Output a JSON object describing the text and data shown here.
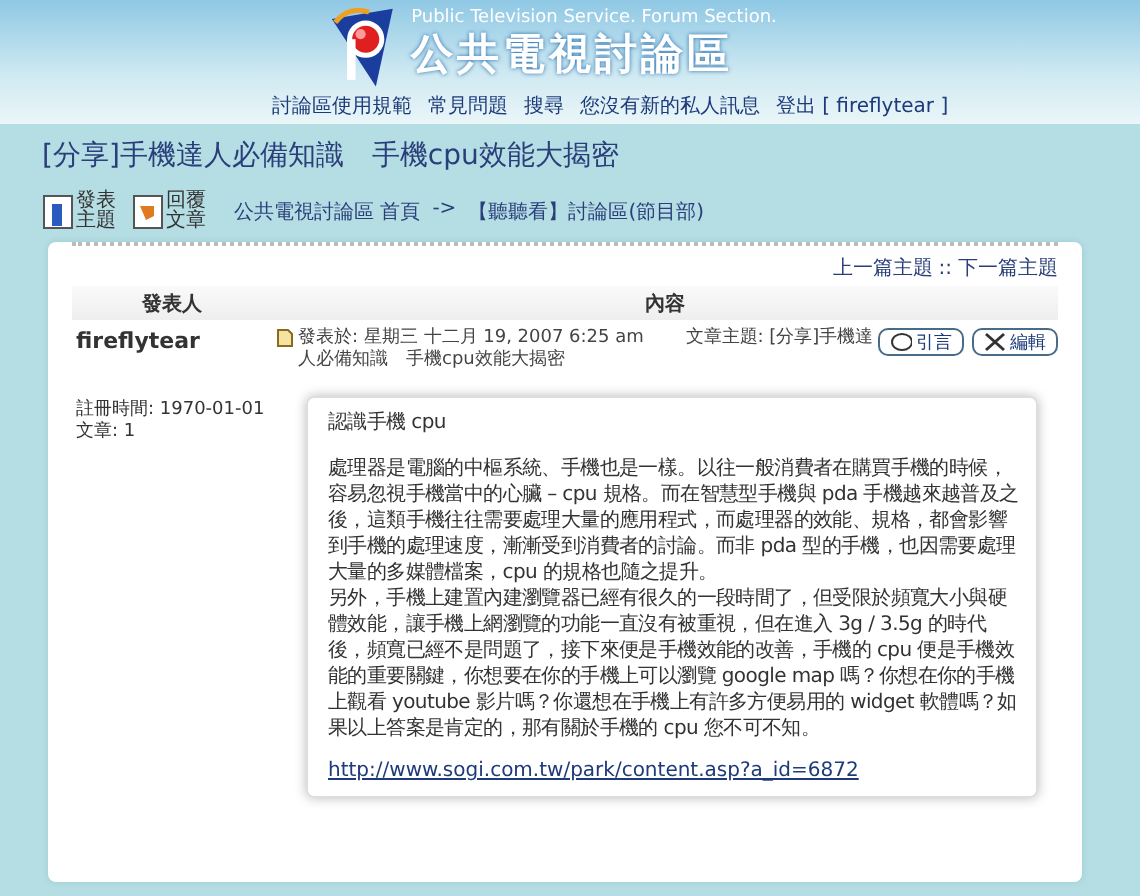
{
  "header": {
    "tagline": "Public Television Service. Forum Section.",
    "site_title": "公共電視討論區",
    "nav": [
      "討論區使用規範",
      "常見問題",
      "搜尋",
      "您沒有新的私人訊息",
      "登出 [ fireflytear ]"
    ]
  },
  "topic_title": "[分享]手機達人必備知識　手機cpu效能大揭密",
  "toolbar": {
    "buttons": [
      {
        "kind": "new",
        "label": "發表主題"
      },
      {
        "kind": "reply",
        "label": "回覆文章"
      }
    ],
    "breadcrumb": [
      "公共電視討論區 首頁",
      "->",
      "【聽聽看】討論區(節目部)"
    ]
  },
  "topic_nav": [
    "上一篇主題",
    "::",
    "下一篇主題"
  ],
  "table": {
    "columns": [
      "發表人",
      "內容"
    ]
  },
  "post": {
    "author": "fireflytear",
    "joined": "註冊時間: 1970-01-01",
    "posts": "文章: 1",
    "posted": "發表於: 星期三 十二月 19, 2007 6:25 am",
    "subject": "文章主題: [分享]手機達人必備知識　手機cpu效能大揭密",
    "buttons": [
      {
        "kind": "quote",
        "label": "引言"
      },
      {
        "kind": "edit",
        "label": "編輯"
      }
    ],
    "body": {
      "heading": "認識手機 cpu",
      "paragraphs": [
        "處理器是電腦的中樞系統、手機也是一樣。以往一般消費者在購買手機的時候，容易忽視手機當中的心臟 – cpu 規格。而在智慧型手機與 pda 手機越來越普及之後，這類手機往往需要處理大量的應用程式，而處理器的效能、規格，都會影響到手機的處理速度，漸漸受到消費者的討論。而非 pda 型的手機，也因需要處理大量的多媒體檔案，cpu 的規格也隨之提升。",
        "另外，手機上建置內建瀏覽器已經有很久的一段時間了，但受限於頻寬大小與硬體效能，讓手機上網瀏覽的功能一直沒有被重視，但在進入 3g / 3.5g 的時代後，頻寬已經不是問題了，接下來便是手機效能的改善，手機的 cpu 便是手機效能的重要關鍵，你想要在你的手機上可以瀏覽 google map 嗎？你想在你的手機上觀看 youtube 影片嗎？你還想在手機上有許多方便易用的 widget 軟體嗎？如果以上答案是肯定的，那有關於手機的 cpu 您不可不知。"
      ],
      "link": "http://www.sogi.com.tw/park/content.asp?a_id=6872"
    }
  }
}
